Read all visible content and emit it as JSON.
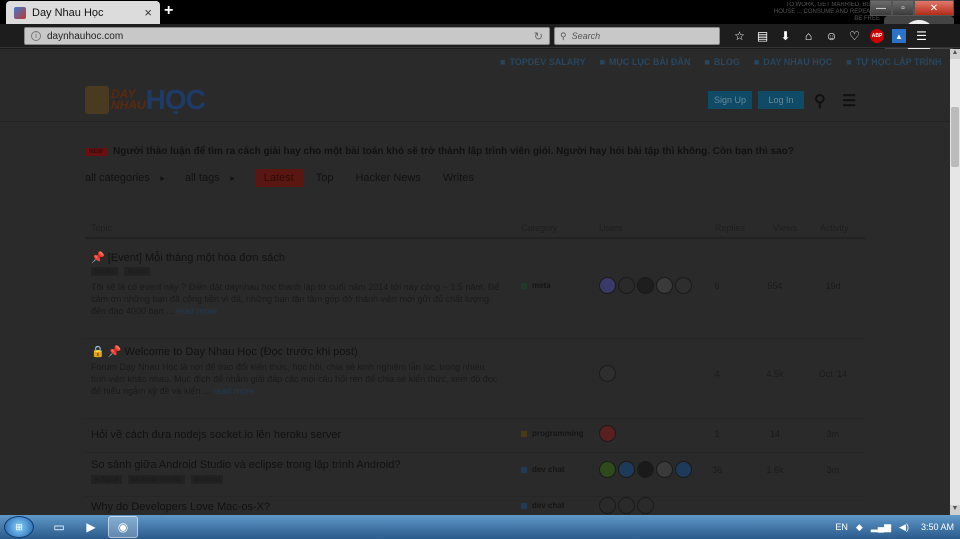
{
  "browser": {
    "tab_title": "Day Nhau Học",
    "tab_close": "×",
    "new_tab": "+",
    "url": "daynhauhoc.com",
    "search_placeholder": "Search",
    "window_controls": [
      "—",
      "▫",
      "✕"
    ],
    "toolbar_icons": [
      "star-icon",
      "reader-icon",
      "download-icon",
      "home-icon",
      "chat-icon",
      "pocket-icon",
      "adblock-icon",
      "extension-icon",
      "menu-icon"
    ],
    "promo_text": "TO WORK, GET MARRIED, BUY A HOUSE ... CONSUME AND REPEAT ... BE FREE"
  },
  "site": {
    "top_links": [
      "TOPDEV SALARY",
      "MỤC LỤC BÀI ĐĂN",
      "BLOG",
      "DAY NHAU HỌC",
      "TỰ HỌC LẬP TRÌNH"
    ],
    "logo_small": "DAY\nNHAU",
    "logo_big": "HỌC",
    "signup": "Sign Up",
    "login": "Log In",
    "banner_badge": "NEW",
    "banner_text": "Người thảo luận để tìm ra cách giải hay cho một bài toán khó sẽ trở thành lập trình viên giỏi. Người hay hỏi bài tập thì không. Còn bạn thì sao?",
    "filters": {
      "categories": "all categories",
      "tags": "all tags",
      "tabs": [
        "Latest",
        "Top",
        "Hacker News",
        "Writes"
      ],
      "active": "Latest"
    },
    "columns": [
      "Topic",
      "Category",
      "Users",
      "Replies",
      "Views",
      "Activity"
    ]
  },
  "topics": [
    {
      "title": "📌 [Event] Mỗi tháng một hóa đơn sách",
      "tags": [
        "books",
        "event"
      ],
      "excerpt": "Tôi sẽ là có event này ? Điền đặt daynhau học thanh lập từ cuối năm 2014 tới nay công ~ 1.5 năm. Để cảm ơn những bạn đã cộng tiền vì đã, những bạn tận tâm góp đỡ thành viên mới gửi đủ chất lượng đến đáo 4000 bạn ...",
      "more": "read more",
      "category": "meta",
      "category_color": "#1f3b28",
      "users": [
        "#3a3a6a",
        "#2a2a2a",
        "#1e1e1e",
        "#3a3a3a",
        "#2e2e2e"
      ],
      "replies": "6",
      "views": "554",
      "activity": "19d"
    },
    {
      "title": "🔒 📌 Welcome to Day Nhau Học (Đọc trước khi post)",
      "tags": [],
      "excerpt": "Forum Dạy Nhau Học là nơi để trao đổi kiến thức, học hỏi, chia sẻ kinh nghiệm lẫn lúc, trong nhiều tình viên khác nhau. Mục đích để nhằm giải đáp các mọi câu hỏi rèn để chia sẻ kiến thức, xem đồ đọc để hiểu ngắm kỹ đề và kiến ...",
      "more": "read more",
      "category": "",
      "category_color": "#2a2a2a",
      "users": [
        "#2e2e2e"
      ],
      "replies": "4",
      "views": "4.5k",
      "activity": "Oct '14"
    },
    {
      "title": "Hỏi về cách đưa nodejs socket.io lên heroku server",
      "tags": [],
      "excerpt": "",
      "more": "",
      "category": "programming",
      "category_color": "#4a3a10",
      "users": [
        "#5a1f1f"
      ],
      "replies": "1",
      "views": "14",
      "activity": "3m"
    },
    {
      "title": "So sánh giữa Android Studio và eclipse trong lập trình Android?",
      "tags": [
        "eclipse",
        "android-studio",
        "android"
      ],
      "excerpt": "",
      "more": "",
      "category": "dev chat",
      "category_color": "#1e3a5a",
      "users": [
        "#2e4a1a",
        "#1e3a5a",
        "#1a1a1a",
        "#3a3a3a",
        "#1e3a5a"
      ],
      "replies": "36",
      "views": "1.6k",
      "activity": "3m"
    },
    {
      "title": "Why do Developers Love Mac-os-X?",
      "tags": [],
      "excerpt": "",
      "more": "",
      "category": "dev chat",
      "category_color": "#1e3a5a",
      "users": [
        "#2a2a2a",
        "#2a2a2a",
        "#2a2a2a"
      ],
      "replies": "",
      "views": "",
      "activity": ""
    }
  ],
  "taskbar": {
    "start": "⊞",
    "language": "EN",
    "clock": "3:50 AM"
  }
}
